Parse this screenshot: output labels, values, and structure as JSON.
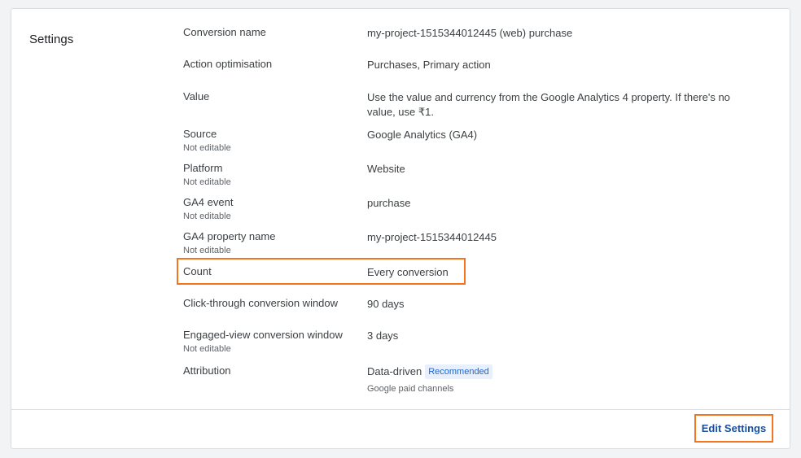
{
  "section_title": "Settings",
  "rows": [
    {
      "label": "Conversion name",
      "sub": "",
      "value": "my-project-1515344012445 (web) purchase"
    },
    {
      "label": "Action optimisation",
      "sub": "",
      "value": "Purchases, Primary action"
    },
    {
      "label": "Value",
      "sub": "",
      "value": "Use the value and currency from the Google Analytics 4 property. If there's no value, use ₹1."
    },
    {
      "label": "Source",
      "sub": "Not editable",
      "value": "Google Analytics (GA4)"
    },
    {
      "label": "Platform",
      "sub": "Not editable",
      "value": "Website"
    },
    {
      "label": "GA4 event",
      "sub": "Not editable",
      "value": "purchase"
    },
    {
      "label": "GA4 property name",
      "sub": "Not editable",
      "value": "my-project-1515344012445"
    },
    {
      "label": "Count",
      "sub": "",
      "value": "Every conversion"
    },
    {
      "label": "Click-through conversion window",
      "sub": "",
      "value": "90 days"
    },
    {
      "label": "Engaged-view conversion window",
      "sub": "Not editable",
      "value": "3 days"
    },
    {
      "label": "Attribution",
      "sub": "",
      "value": "Data-driven",
      "badge": "Recommended",
      "value_sub": "Google paid channels"
    }
  ],
  "footer": {
    "edit_button": "Edit Settings"
  },
  "colors": {
    "highlight_border": "#f4731f",
    "link": "#1a4fa0",
    "badge_bg": "#e8f0fe",
    "badge_text": "#1967d2"
  }
}
